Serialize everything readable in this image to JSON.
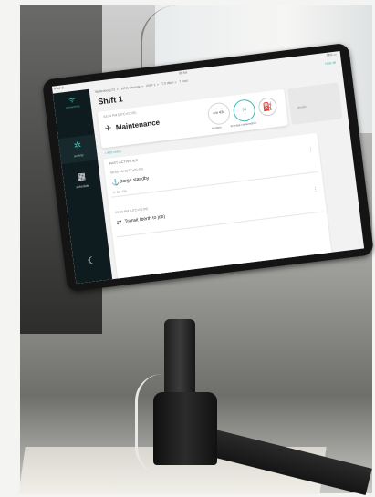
{
  "status_bar": {
    "network": "iPad ᯤ",
    "time": "09:54",
    "battery": "74% ▭"
  },
  "sidebar": {
    "logo_icon": "ᯤ",
    "logo_label": "connectivity",
    "items": [
      {
        "label": "activity",
        "icon": "✲",
        "active": true
      },
      {
        "label": "schedule",
        "icon": "▦",
        "active": false
      }
    ],
    "moon_icon": "☾"
  },
  "breadcrumb": [
    "Wallenberg 02",
    "MTG Stavnar",
    "ANR 1",
    "7.0 Wait",
    "7 hour"
  ],
  "top_right_link": "Hide all",
  "page_title": "Shift 1",
  "current_activity": {
    "since": "04:54 PM (UTC+01:00)",
    "name": "Maintenance",
    "icon": "✈",
    "gauges": [
      {
        "value": "4m 43s",
        "label": "duration",
        "highlight": false
      },
      {
        "value": "33",
        "label": "average consumption",
        "highlight": true
      }
    ]
  },
  "edit_label": "details",
  "add_note": "+ Add notes",
  "past_activities": {
    "heading": "PAST ACTIVITIES",
    "items": [
      {
        "time": "09:55 PM (UTC+01:00)",
        "icon": "⚓",
        "name": "Barge standby",
        "duration": "⟳ 3m 40s"
      },
      {
        "time": "09:50 PM (UTC+01:00)",
        "icon": "⇄",
        "name": "Transit (berth to job)",
        "duration": ""
      }
    ]
  }
}
